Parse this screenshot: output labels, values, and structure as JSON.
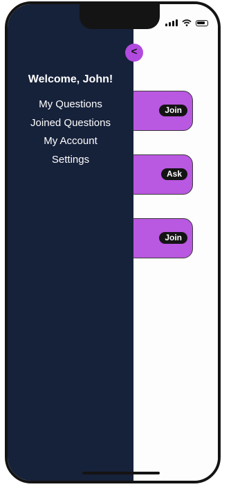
{
  "drawer": {
    "welcome": "Welcome, John!",
    "items": [
      {
        "label": "My Questions"
      },
      {
        "label": "Joined Questions"
      },
      {
        "label": "My Account"
      },
      {
        "label": "Settings"
      }
    ]
  },
  "back_button": {
    "label": "<",
    "color": "#b14bdf"
  },
  "cards": [
    {
      "button_label": "Join"
    },
    {
      "button_label": "Ask"
    },
    {
      "button_label": "Join"
    }
  ],
  "colors": {
    "drawer_bg": "#16213a",
    "card_bg": "#b958e0",
    "button_bg": "#141414"
  },
  "status_icons": [
    "signal-icon",
    "wifi-icon",
    "battery-icon"
  ]
}
